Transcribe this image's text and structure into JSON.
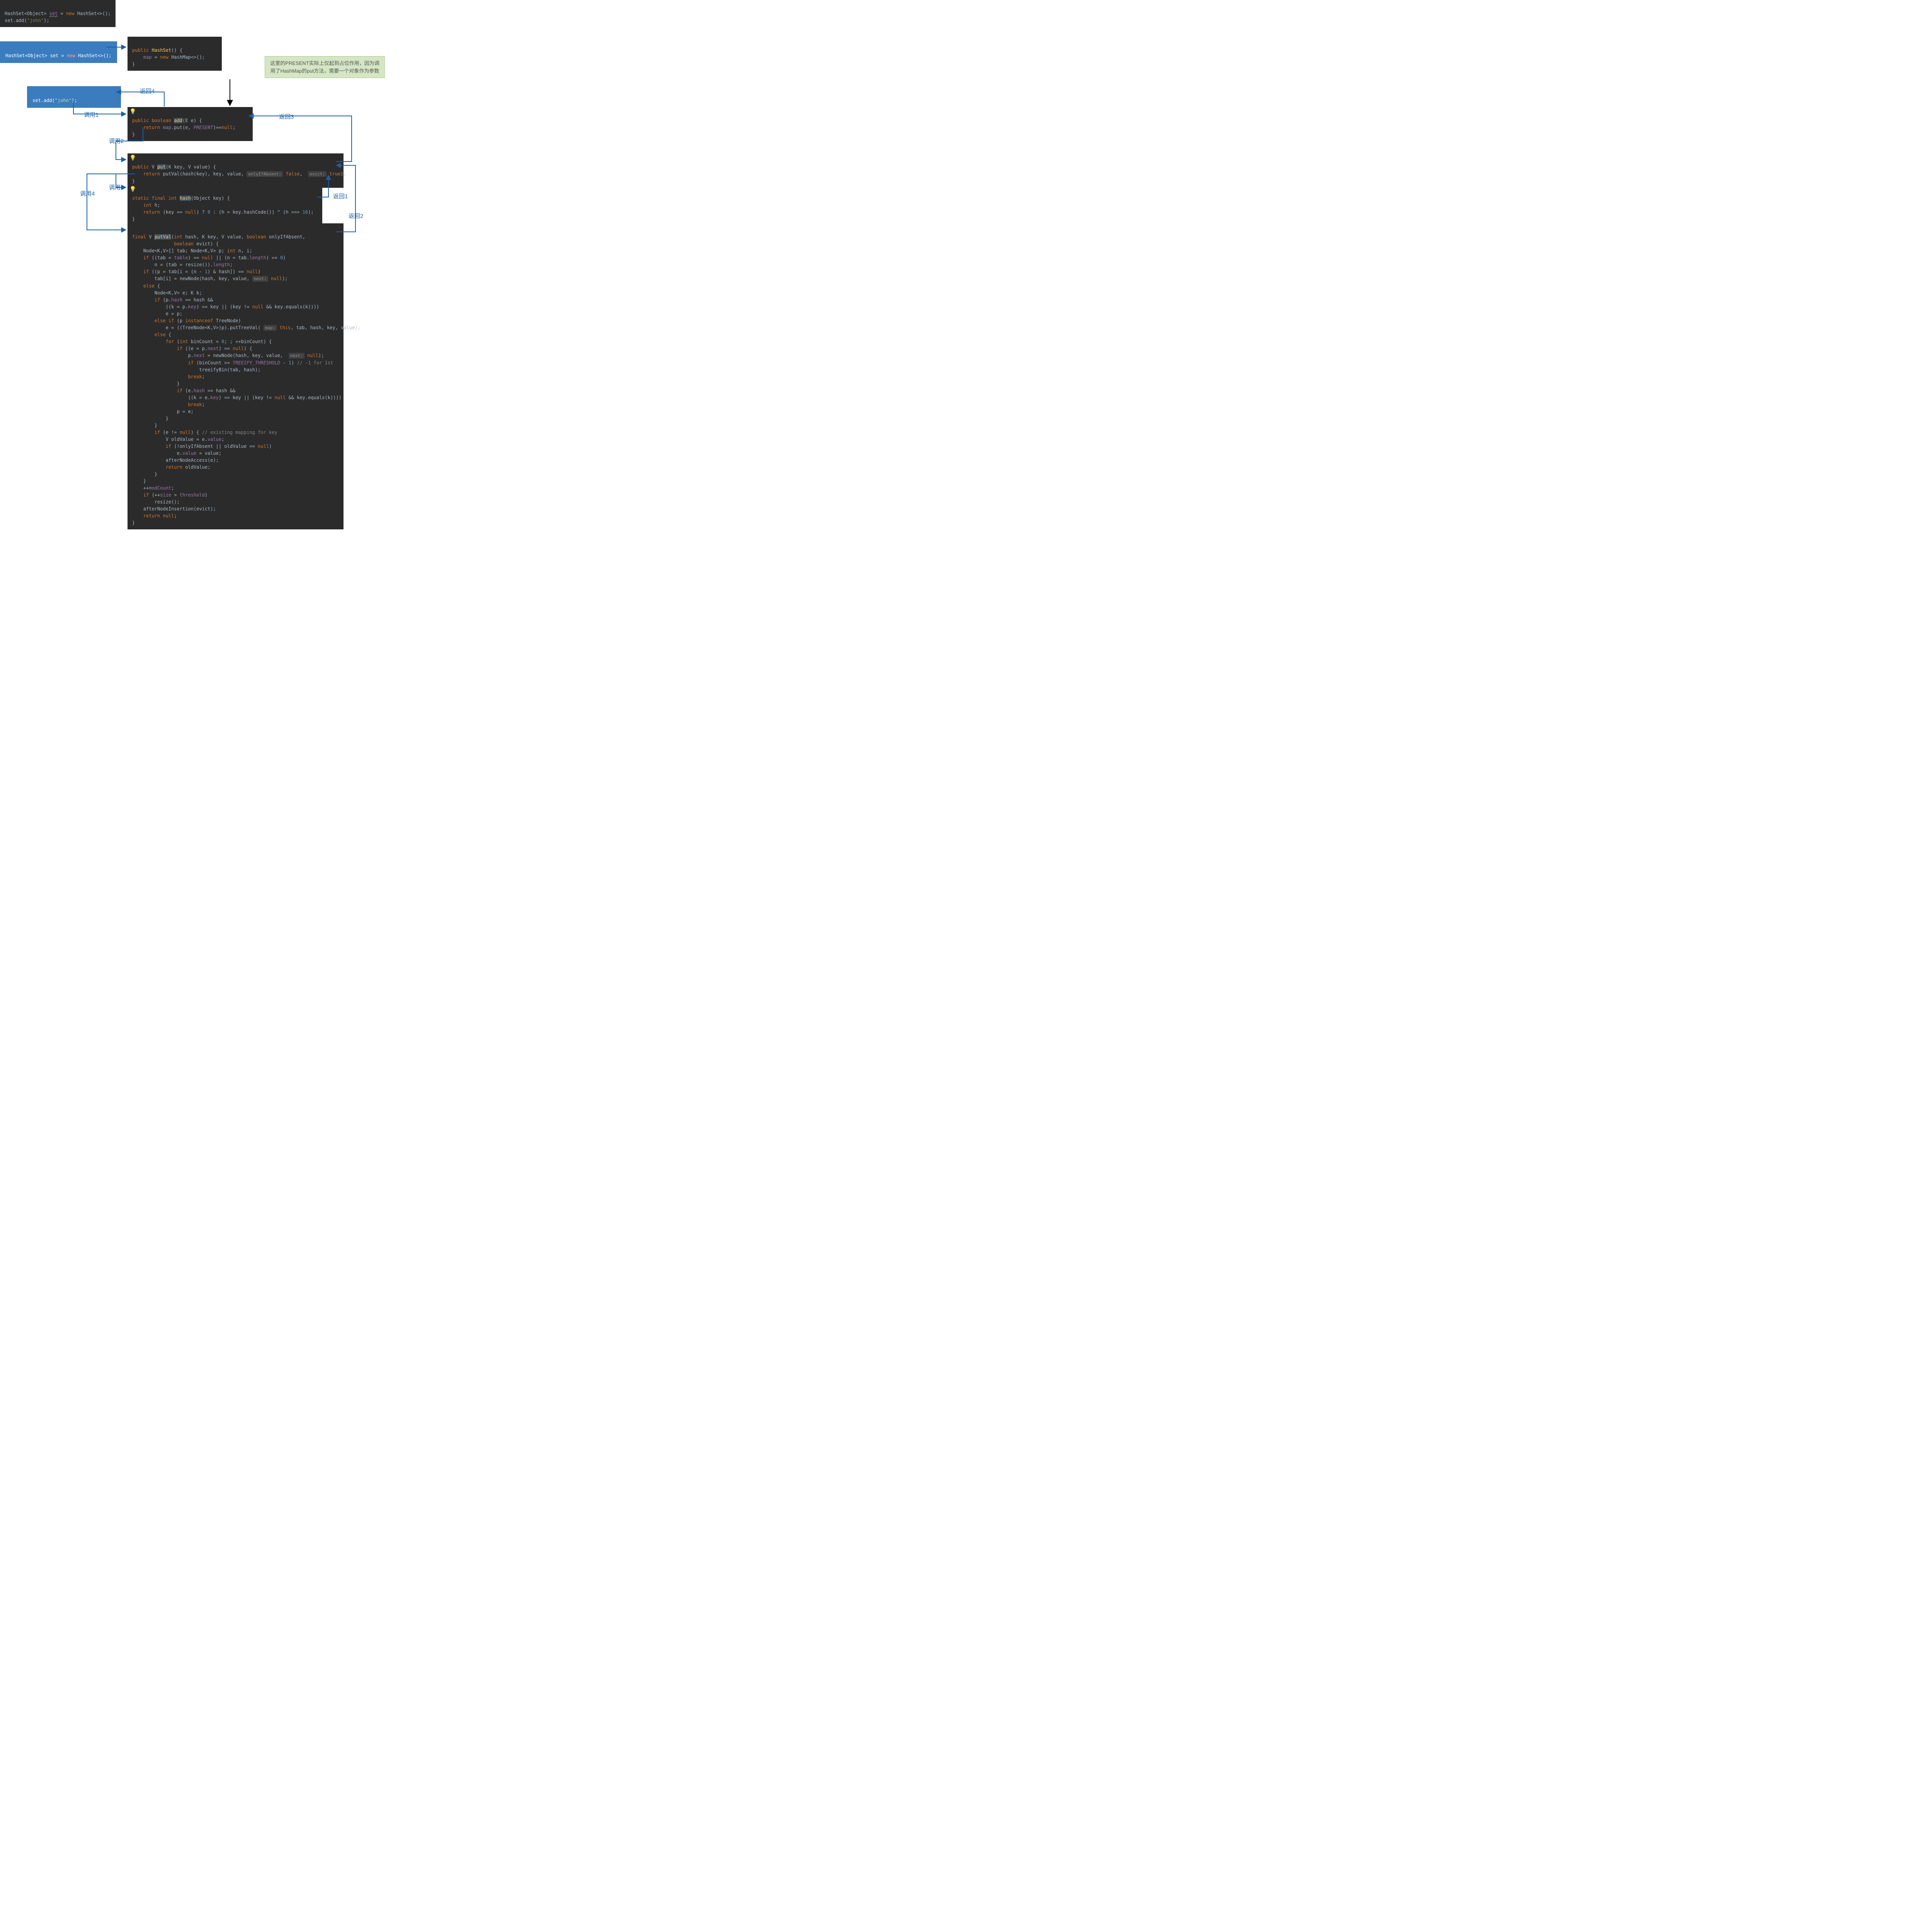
{
  "blocks": {
    "top_code": "HashSet<Object> set = new HashSet<>();\nset.add(\"john\");",
    "blue_declare": "HashSet<Object> set = new HashSet<>();",
    "blue_add": "set.add(\"john\");",
    "hashset_ctor": "public HashSet() {\n    map = new HashMap<>();\n}",
    "add_method": "public boolean add(E e) {\n    return map.put(e, PRESENT)==null;\n}",
    "put_method": "public V put(K key, V value) {\n    return putVal(hash(key), key, value, onlyIfAbsent: false,  evict: true);\n}",
    "hash_method": "static final int hash(Object key) {\n    int h;\n    return (key == null) ? 0 : (h = key.hashCode()) ^ (h >>> 16);\n}",
    "putval_method": "final V putVal(int hash, K key, V value, boolean onlyIfAbsent,\n               boolean evict) {\n    Node<K,V>[] tab; Node<K,V> p; int n, i;\n    if ((tab = table) == null || (n = tab.length) == 0)\n        n = (tab = resize()).length;\n    if ((p = tab[i = (n - 1) & hash]) == null)\n        tab[i] = newNode(hash, key, value, next: null);\n    else {\n        Node<K,V> e; K k;\n        if (p.hash == hash &&\n            ((k = p.key) == key || (key != null && key.equals(k))))\n            e = p;\n        else if (p instanceof TreeNode)\n            e = ((TreeNode<K,V>)p).putTreeVal( map: this, tab, hash, key, value);\n        else {\n            for (int binCount = 0; ; ++binCount) {\n                if ((e = p.next) == null) {\n                    p.next = newNode(hash, key, value,  next: null);\n                    if (binCount >= TREEIFY_THRESHOLD - 1) // -1 for 1st\n                        treeifyBin(tab, hash);\n                    break;\n                }\n                if (e.hash == hash &&\n                    ((k = e.key) == key || (key != null && key.equals(k))))\n                    break;\n                p = e;\n            }\n        }\n        if (e != null) { // existing mapping for key\n            V oldValue = e.value;\n            if (!onlyIfAbsent || oldValue == null)\n                e.value = value;\n            afterNodeAccess(e);\n            return oldValue;\n        }\n    }\n    ++modCount;\n    if (++size > threshold)\n        resize();\n    afterNodeInsertion(evict);\n    return null;\n}"
  },
  "note": "这里的PRESENT实际上仅起到占位作用，因为调用了HashMap的put方法，需要一个对象作为参数",
  "labels": {
    "call1": "调用1",
    "call2": "调用2",
    "call3": "调用3",
    "call4": "调用4",
    "ret1": "返回1",
    "ret2": "返回2",
    "ret3": "返回3",
    "ret4": "返回4"
  },
  "arrow_color_blue": "#1B5FA8",
  "arrow_color_black": "#000000"
}
